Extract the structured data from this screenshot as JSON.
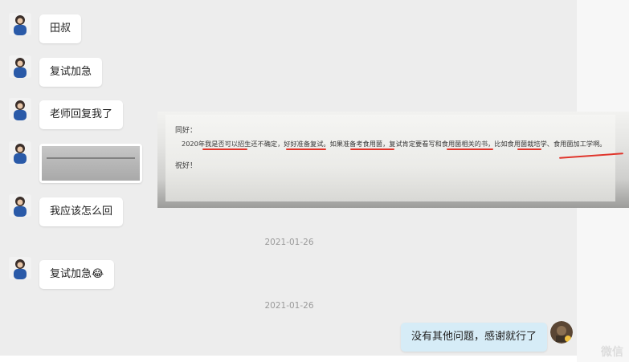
{
  "messages": {
    "m1": "田叔",
    "m2": "复试加急",
    "m3": "老师回复我了",
    "m4": "我应该怎么回",
    "m5": "复试加急😂",
    "self1": "没有其他问题，感谢就行了"
  },
  "timestamps": {
    "t1": "2021-01-26",
    "t2": "2021-01-26"
  },
  "photo": {
    "greeting": "同好：",
    "body": "2020年我是否可以招生还不确定，好好准备复试。如果准备考食用菌，复试肯定要看写和食用菌相关的书，比如食用菌栽培学、食用菌加工学啊。",
    "closing": "祝好！"
  },
  "watermark": "微信",
  "colors": {
    "chat_bg": "#ededed",
    "self_bubble": "#d6ecf7",
    "underline": "#e0352b"
  }
}
